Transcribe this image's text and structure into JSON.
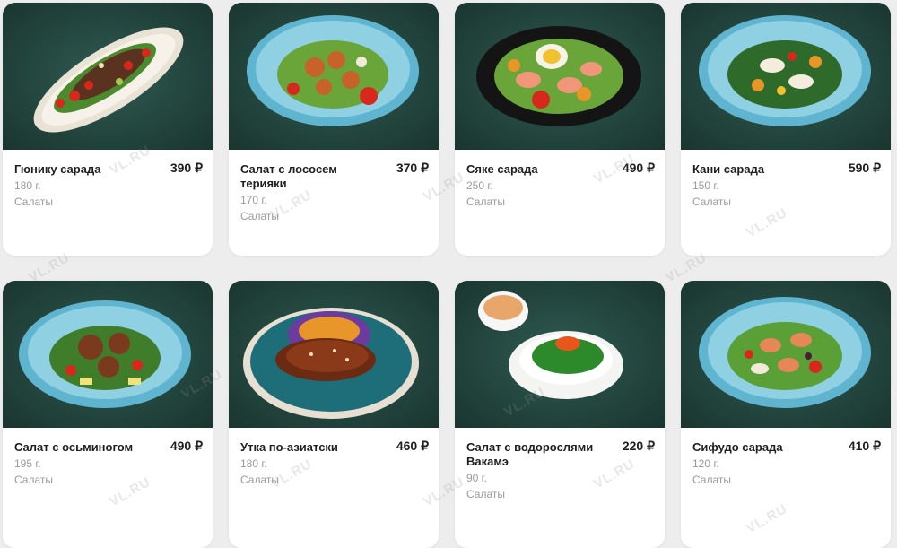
{
  "watermark": "VL.RU",
  "products": [
    {
      "name": "Гюнику сарада",
      "price": "390 ₽",
      "weight": "180 г.",
      "category": "Салаты",
      "image": "beef-salad-oval-plate"
    },
    {
      "name": "Салат с лососем терияки",
      "price": "370 ₽",
      "weight": "170 г.",
      "category": "Салаты",
      "image": "salmon-salad-blue-bowl"
    },
    {
      "name": "Сяке сарада",
      "price": "490 ₽",
      "weight": "250 г.",
      "category": "Салаты",
      "image": "salmon-egg-salad-black-plate"
    },
    {
      "name": "Кани сарада",
      "price": "590 ₽",
      "weight": "150 г.",
      "category": "Салаты",
      "image": "crab-salad-blue-bowl"
    },
    {
      "name": "Салат с осьминогом",
      "price": "490 ₽",
      "weight": "195 г.",
      "category": "Салаты",
      "image": "octopus-salad-blue-bowl"
    },
    {
      "name": "Утка по-азиатски",
      "price": "460 ₽",
      "weight": "180 г.",
      "category": "Салаты",
      "image": "asian-duck-teal-plate"
    },
    {
      "name": "Салат с водорослями Вакамэ",
      "price": "220 ₽",
      "weight": "90 г.",
      "category": "Салаты",
      "image": "wakame-salad-white-bowl"
    },
    {
      "name": "Сифудо сарада",
      "price": "410 ₽",
      "weight": "120 г.",
      "category": "Салаты",
      "image": "seafood-salad-blue-bowl"
    }
  ]
}
